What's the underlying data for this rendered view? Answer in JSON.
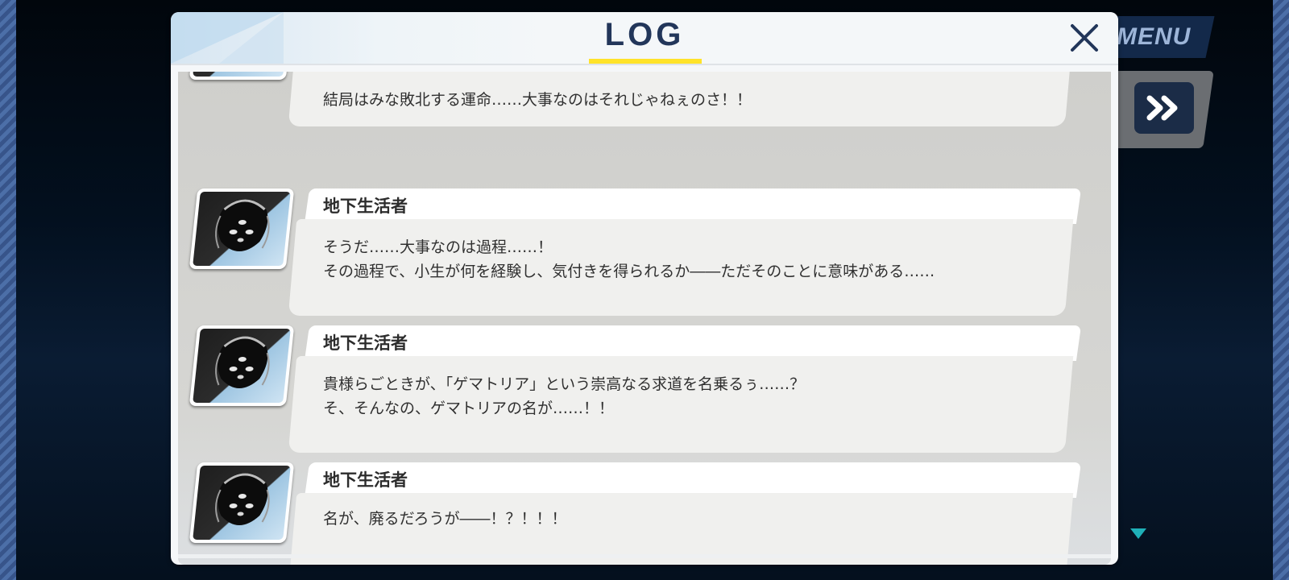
{
  "game_menu": {
    "menu_label": "MENU"
  },
  "dialog": {
    "title": "LOG"
  },
  "log_entries": [
    {
      "name": "",
      "lines": [
        "結局はみな敗北する運命……大事なのはそれじゃねぇのさ！！"
      ]
    },
    {
      "name": "地下生活者",
      "lines": [
        "そうだ……大事なのは過程……！",
        "その過程で、小生が何を経験し、気付きを得られるか――ただそのことに意味がある……"
      ]
    },
    {
      "name": "地下生活者",
      "lines": [
        "貴様らごときが、「ゲマトリア」という崇高なる求道を名乗るぅ……？",
        "そ、そんなの、ゲマトリアの名が……！！"
      ]
    },
    {
      "name": "地下生活者",
      "lines": [
        "名が、廃るだろうが――！？！！！"
      ]
    }
  ],
  "icons": {
    "close": "close-x-icon",
    "skip": "fast-forward-icon",
    "next": "triangle-down-icon"
  },
  "colors": {
    "title_text": "#22365a",
    "title_underline": "#ffe32a",
    "menu_button": "#13294a",
    "accent_arrow": "#1fb0b8"
  }
}
